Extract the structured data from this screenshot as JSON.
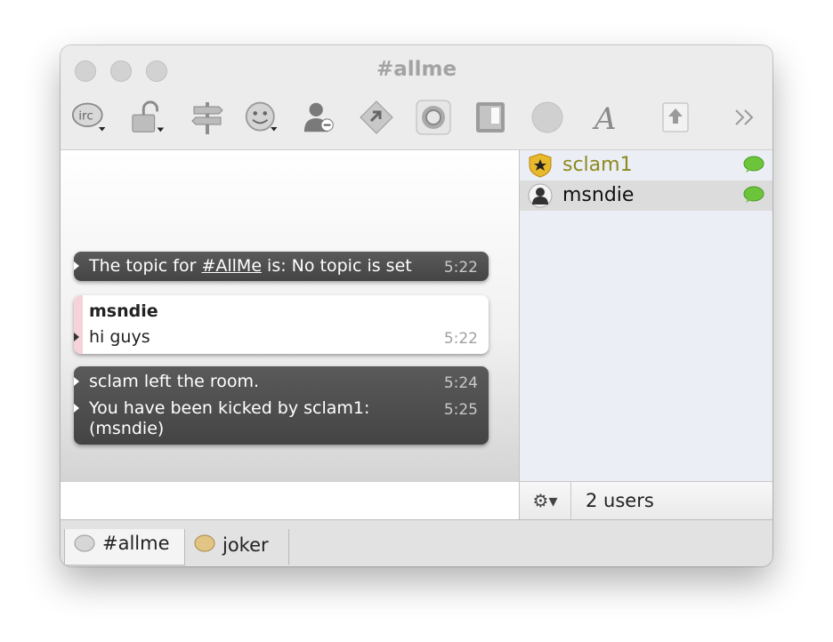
{
  "window": {
    "title": "#allme"
  },
  "toolbar": {
    "icons": [
      "irc-icon",
      "lock-icon",
      "signpost-icon",
      "smiley-icon",
      "user-remove-icon",
      "send-file-icon",
      "record-icon",
      "contacts-book-icon",
      "status-circle-icon",
      "font-icon",
      "share-icon",
      "overflow-chevrons-icon"
    ]
  },
  "chat": {
    "topic": {
      "prefix": "The topic for ",
      "channel": "#AllMe",
      "suffix": " is: No topic is set",
      "time": "5:22"
    },
    "message": {
      "sender": "msndie",
      "text": "hi guys",
      "time": "5:22"
    },
    "events": [
      {
        "text": "sclam left the room.",
        "time": "5:24"
      },
      {
        "text": "You have been kicked by sclam1:",
        "text2": "(msndie)",
        "time": "5:25"
      }
    ]
  },
  "users": [
    {
      "name": "sclam1",
      "color": "#8c8a1e",
      "role": "operator"
    },
    {
      "name": "msndie",
      "color": "#111111",
      "role": "member"
    }
  ],
  "userlist_footer": {
    "count_label": "2 users",
    "gear_label": "⚙▾"
  },
  "tabs": [
    {
      "label": "#allme",
      "active": true
    },
    {
      "label": "joker",
      "active": false
    }
  ],
  "colors": {
    "status_green": "#6bc43a",
    "operator_gold": "#e8b92a",
    "selected_row": "#dcdcdc"
  }
}
